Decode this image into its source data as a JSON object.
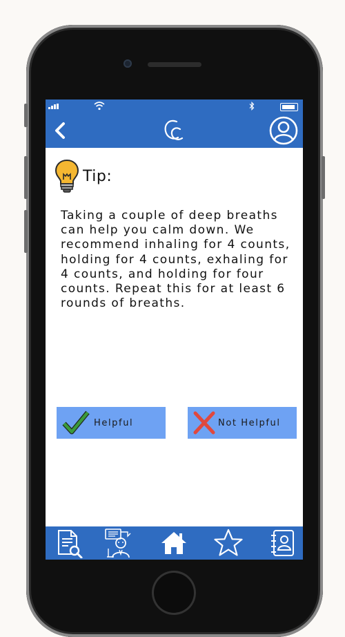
{
  "navbar": {
    "back_icon": "chevron-left-icon",
    "logo_icon": "cc-logo-icon",
    "profile_icon": "user-circle-icon"
  },
  "tip": {
    "icon": "lightbulb-icon",
    "title": "Tip:",
    "body": "Taking a couple of deep breaths can help you calm down. We recommend inhaling for 4 counts, holding for 4 counts, exhaling for 4 counts, and holding for four counts. Repeat this for at least 6 rounds of breaths."
  },
  "feedback": {
    "helpful_label": "Helpful",
    "helpful_icon": "checkmark-icon",
    "not_helpful_label": "Not Helpful",
    "not_helpful_icon": "x-mark-icon"
  },
  "tabbar": {
    "items": [
      {
        "icon": "document-search-icon"
      },
      {
        "icon": "therapist-icon"
      },
      {
        "icon": "home-icon"
      },
      {
        "icon": "star-icon"
      },
      {
        "icon": "contacts-icon"
      }
    ]
  },
  "colors": {
    "primary": "#2f6cc1",
    "button": "#6ea2f3",
    "check": "#3b9a3b",
    "cross": "#e0483e",
    "bulb": "#f5b731"
  }
}
